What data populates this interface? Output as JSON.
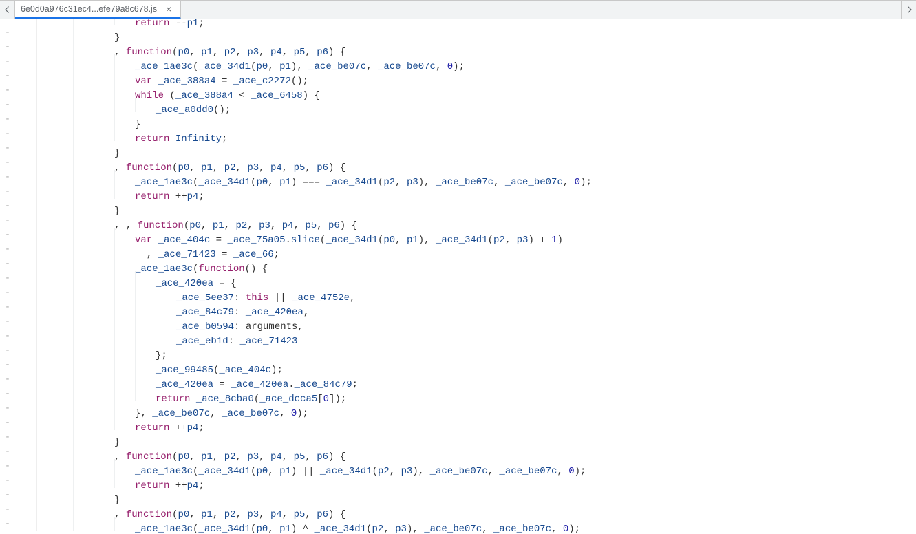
{
  "tab": {
    "label": "6e0d0a976c31ec4...efe79a8c678.js",
    "close": "×"
  },
  "diff_marker": "-",
  "code_lines": [
    {
      "indent": 4,
      "html": "<span class='kw'>return</span> --<span class='param'>p1</span>;"
    },
    {
      "indent": 3,
      "html": "}"
    },
    {
      "indent": 3,
      "html": ", <span class='kw'>function</span>(<span class='param'>p0</span>, <span class='param'>p1</span>, <span class='param'>p2</span>, <span class='param'>p3</span>, <span class='param'>p4</span>, <span class='param'>p5</span>, <span class='param'>p6</span>) {"
    },
    {
      "indent": 4,
      "html": "<span class='id'>_ace_1ae3c</span>(<span class='id'>_ace_34d1</span>(<span class='param'>p0</span>, <span class='param'>p1</span>), <span class='id'>_ace_be07c</span>, <span class='id'>_ace_be07c</span>, <span class='num'>0</span>);"
    },
    {
      "indent": 4,
      "html": "<span class='kw'>var</span> <span class='id'>_ace_388a4</span> = <span class='id'>_ace_c2272</span>();"
    },
    {
      "indent": 4,
      "html": "<span class='kw'>while</span> (<span class='id'>_ace_388a4</span> &lt; <span class='id'>_ace_6458</span>) {"
    },
    {
      "indent": 5,
      "html": "<span class='id'>_ace_a0dd0</span>();"
    },
    {
      "indent": 4,
      "html": "}"
    },
    {
      "indent": 4,
      "html": "<span class='kw'>return</span> <span class='kwv'>Infinity</span>;"
    },
    {
      "indent": 3,
      "html": "}"
    },
    {
      "indent": 3,
      "html": ", <span class='kw'>function</span>(<span class='param'>p0</span>, <span class='param'>p1</span>, <span class='param'>p2</span>, <span class='param'>p3</span>, <span class='param'>p4</span>, <span class='param'>p5</span>, <span class='param'>p6</span>) {"
    },
    {
      "indent": 4,
      "html": "<span class='id'>_ace_1ae3c</span>(<span class='id'>_ace_34d1</span>(<span class='param'>p0</span>, <span class='param'>p1</span>) === <span class='id'>_ace_34d1</span>(<span class='param'>p2</span>, <span class='param'>p3</span>), <span class='id'>_ace_be07c</span>, <span class='id'>_ace_be07c</span>, <span class='num'>0</span>);"
    },
    {
      "indent": 4,
      "html": "<span class='kw'>return</span> ++<span class='param'>p4</span>;"
    },
    {
      "indent": 3,
      "html": "}"
    },
    {
      "indent": 3,
      "html": ", , <span class='kw'>function</span>(<span class='param'>p0</span>, <span class='param'>p1</span>, <span class='param'>p2</span>, <span class='param'>p3</span>, <span class='param'>p4</span>, <span class='param'>p5</span>, <span class='param'>p6</span>) {"
    },
    {
      "indent": 4,
      "html": "<span class='kw'>var</span> <span class='id'>_ace_404c</span> = <span class='id'>_ace_75a05</span>.<span class='id'>slice</span>(<span class='id'>_ace_34d1</span>(<span class='param'>p0</span>, <span class='param'>p1</span>), <span class='id'>_ace_34d1</span>(<span class='param'>p2</span>, <span class='param'>p3</span>) + <span class='num'>1</span>)"
    },
    {
      "indent": 4,
      "html": "  , <span class='id'>_ace_71423</span> = <span class='id'>_ace_66</span>;"
    },
    {
      "indent": 4,
      "html": "<span class='id'>_ace_1ae3c</span>(<span class='kw'>function</span>() {"
    },
    {
      "indent": 5,
      "html": "<span class='id'>_ace_420ea</span> = {"
    },
    {
      "indent": 6,
      "html": "<span class='id'>_ace_5ee37</span>: <span class='kw'>this</span> || <span class='id'>_ace_4752e</span>,"
    },
    {
      "indent": 6,
      "html": "<span class='id'>_ace_84c79</span>: <span class='id'>_ace_420ea</span>,"
    },
    {
      "indent": 6,
      "html": "<span class='id'>_ace_b0594</span>: arguments,"
    },
    {
      "indent": 6,
      "html": "<span class='id'>_ace_eb1d</span>: <span class='id'>_ace_71423</span>"
    },
    {
      "indent": 5,
      "html": "};"
    },
    {
      "indent": 5,
      "html": "<span class='id'>_ace_99485</span>(<span class='id'>_ace_404c</span>);"
    },
    {
      "indent": 5,
      "html": "<span class='id'>_ace_420ea</span> = <span class='id'>_ace_420ea</span>.<span class='id'>_ace_84c79</span>;"
    },
    {
      "indent": 5,
      "html": "<span class='kw'>return</span> <span class='id'>_ace_8cba0</span>(<span class='id'>_ace_dcca5</span>[<span class='num'>0</span>]);"
    },
    {
      "indent": 4,
      "html": "}, <span class='id'>_ace_be07c</span>, <span class='id'>_ace_be07c</span>, <span class='num'>0</span>);"
    },
    {
      "indent": 4,
      "html": "<span class='kw'>return</span> ++<span class='param'>p4</span>;"
    },
    {
      "indent": 3,
      "html": "}"
    },
    {
      "indent": 3,
      "html": ", <span class='kw'>function</span>(<span class='param'>p0</span>, <span class='param'>p1</span>, <span class='param'>p2</span>, <span class='param'>p3</span>, <span class='param'>p4</span>, <span class='param'>p5</span>, <span class='param'>p6</span>) {"
    },
    {
      "indent": 4,
      "html": "<span class='id'>_ace_1ae3c</span>(<span class='id'>_ace_34d1</span>(<span class='param'>p0</span>, <span class='param'>p1</span>) || <span class='id'>_ace_34d1</span>(<span class='param'>p2</span>, <span class='param'>p3</span>), <span class='id'>_ace_be07c</span>, <span class='id'>_ace_be07c</span>, <span class='num'>0</span>);"
    },
    {
      "indent": 4,
      "html": "<span class='kw'>return</span> ++<span class='param'>p4</span>;"
    },
    {
      "indent": 3,
      "html": "}"
    },
    {
      "indent": 3,
      "html": ", <span class='kw'>function</span>(<span class='param'>p0</span>, <span class='param'>p1</span>, <span class='param'>p2</span>, <span class='param'>p3</span>, <span class='param'>p4</span>, <span class='param'>p5</span>, <span class='param'>p6</span>) {"
    },
    {
      "indent": 4,
      "html": "<span class='id'>_ace_1ae3c</span>(<span class='id'>_ace_34d1</span>(<span class='param'>p0</span>, <span class='param'>p1</span>) ^ <span class='id'>_ace_34d1</span>(<span class='param'>p2</span>, <span class='param'>p3</span>), <span class='id'>_ace_be07c</span>, <span class='id'>_ace_be07c</span>, <span class='num'>0</span>);"
    }
  ]
}
